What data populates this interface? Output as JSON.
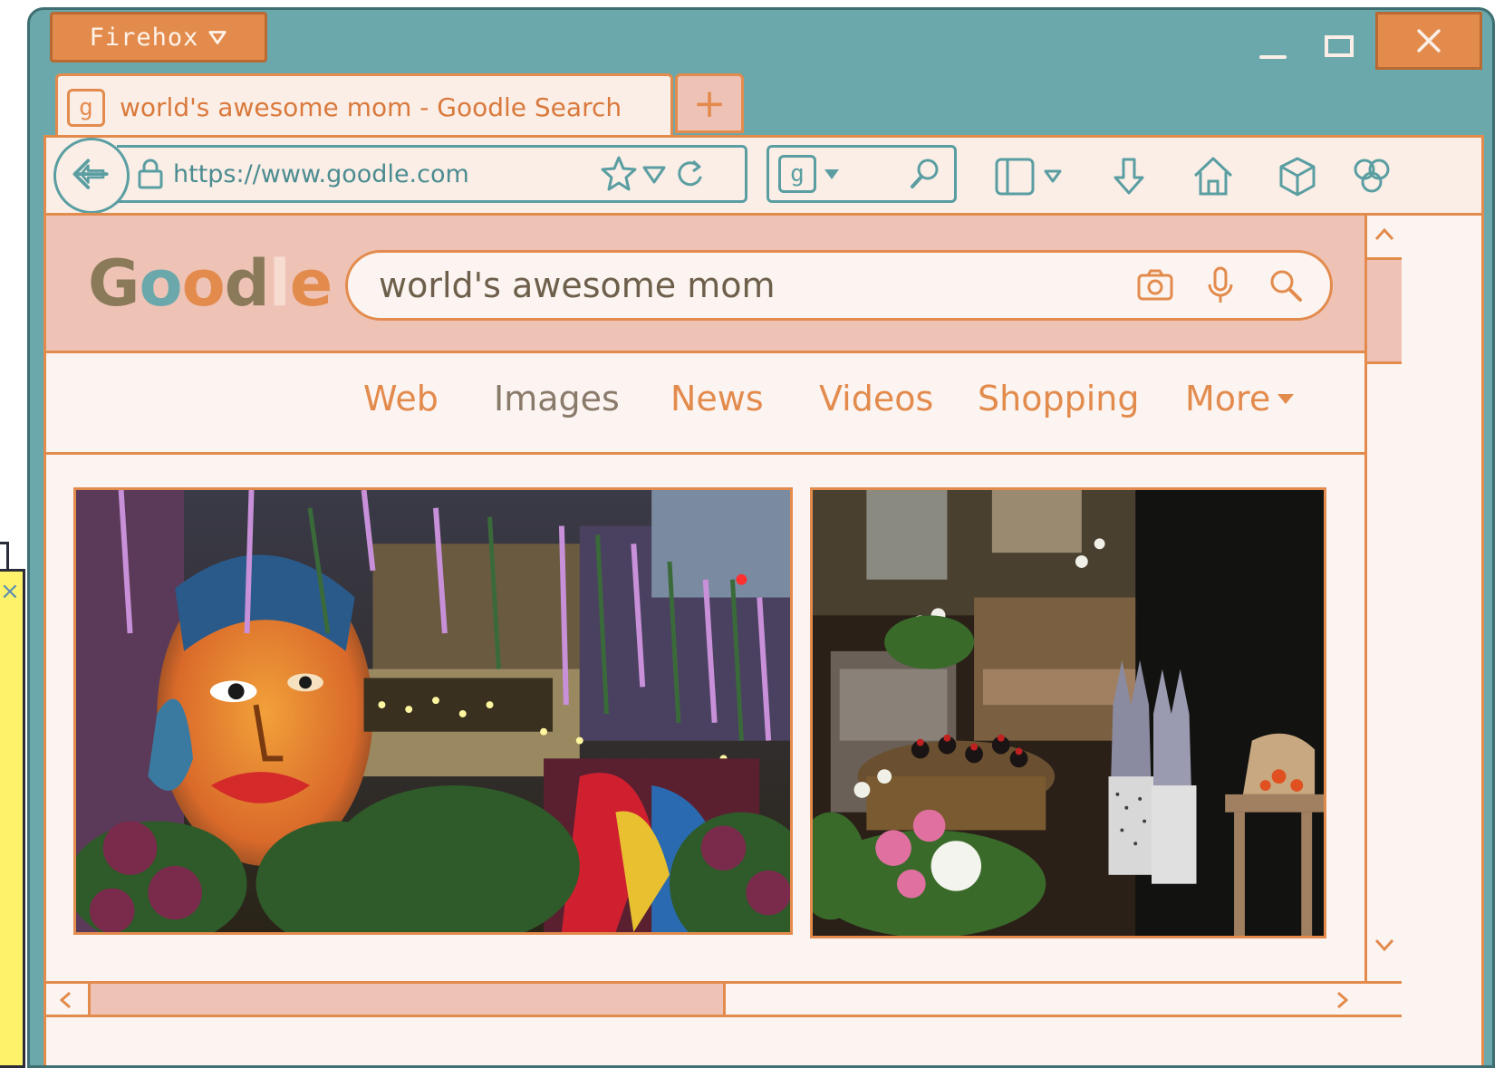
{
  "browser": {
    "brand_label": "Firehox",
    "tab": {
      "favicon": "g",
      "title": "world's awesome mom - Goodle Search"
    },
    "new_tab_label": "+",
    "url": "https://www.goodle.com",
    "search_engine_favicon": "g"
  },
  "page": {
    "logo": {
      "letters": [
        "G",
        "o",
        "o",
        "d",
        "l",
        "e"
      ]
    },
    "search_query": "world's awesome mom",
    "nav": [
      "Web",
      "Images",
      "News",
      "Videos",
      "Shopping",
      "More"
    ],
    "active_nav": "Images"
  },
  "colors": {
    "window_frame": "#6aa8ab",
    "accent_orange": "#e38b4d",
    "teal": "#5a9ea2",
    "header_pink": "#eec3b6",
    "page_bg": "#fbf4f1",
    "logo_letter_colors": [
      "#8a7a5a",
      "#6aa8ab",
      "#e38b4d",
      "#8a7a5a",
      "#f4d0c4",
      "#e38b4d"
    ]
  },
  "icons": {
    "brand_menu": "chevron-down-icon",
    "window_controls": [
      "minimize-icon",
      "maximize-icon",
      "close-icon"
    ],
    "toolbar": [
      "back-arrow-icon",
      "lock-icon",
      "star-icon",
      "dropdown-icon",
      "reload-icon",
      "search-icon",
      "sidebar-icon",
      "download-icon",
      "home-icon",
      "extension-cube-icon",
      "flower-icon"
    ],
    "search_box": [
      "camera-icon",
      "microphone-icon",
      "search-icon"
    ]
  }
}
